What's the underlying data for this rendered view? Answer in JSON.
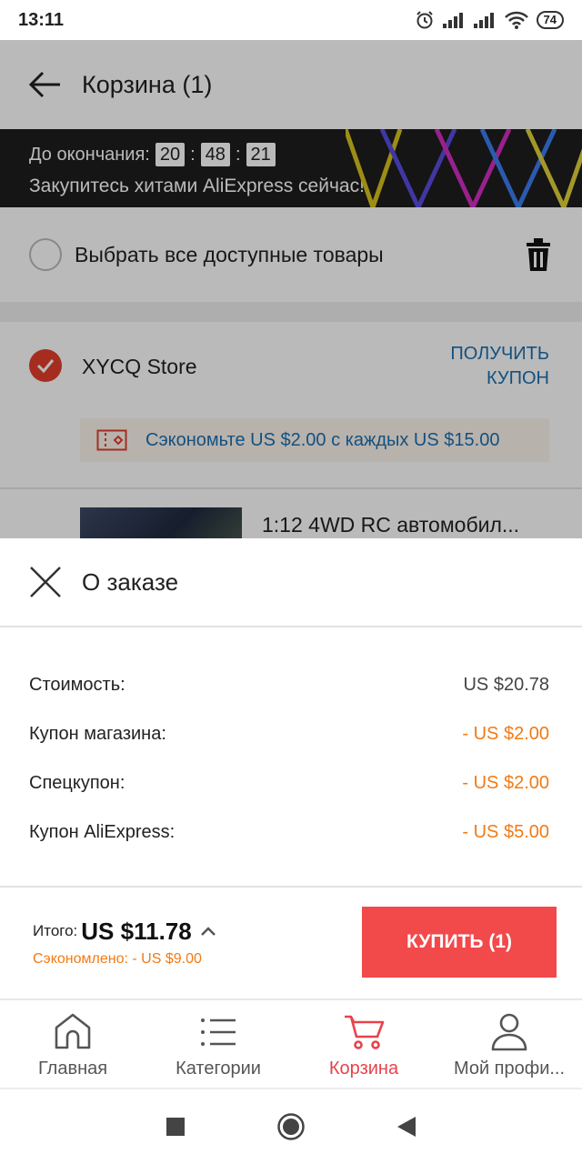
{
  "status_bar": {
    "time": "13:11",
    "battery": "74"
  },
  "cart": {
    "title": "Корзина (1)",
    "promo": {
      "countdown_label": "До окончания:",
      "hours": "20",
      "minutes": "48",
      "seconds": "21",
      "separator": ":",
      "subtitle": "Закупитесь хитами AliExpress сейчас!"
    },
    "select_all_label": "Выбрать все доступные товары",
    "store": {
      "name": "XYCQ Store",
      "get_coupon_line1": "ПОЛУЧИТЬ",
      "get_coupon_line2": "КУПОН",
      "coupon_text": "Сэкономьте US $2.00 с каждых US $15.00"
    },
    "product_title": "1:12 4WD RC автомобил..."
  },
  "order": {
    "title": "О заказе",
    "rows": [
      {
        "label": "Стоимость:",
        "value": "US $20.78",
        "discount": false
      },
      {
        "label": "Купон магазина:",
        "value": "- US $2.00",
        "discount": true
      },
      {
        "label": "Спецкупон:",
        "value": "- US $2.00",
        "discount": true
      },
      {
        "label": "Купон AliExpress:",
        "value": "- US $5.00",
        "discount": true
      }
    ],
    "total_label": "Итого:",
    "total_value": "US $11.78",
    "saved": "Сэкономлено: - US $9.00",
    "buy_label": "КУПИТЬ (1)"
  },
  "bottom_nav": {
    "items": [
      {
        "label": "Главная",
        "icon": "home-icon"
      },
      {
        "label": "Категории",
        "icon": "list-icon"
      },
      {
        "label": "Корзина",
        "icon": "cart-icon"
      },
      {
        "label": "Мой профи...",
        "icon": "profile-icon"
      }
    ],
    "active_index": 2
  },
  "colors": {
    "accent": "#e8424a",
    "buy_button": "#f2494b",
    "discount": "#f27a14",
    "link": "#1b6fae",
    "checkbox": "#e23e2b"
  }
}
